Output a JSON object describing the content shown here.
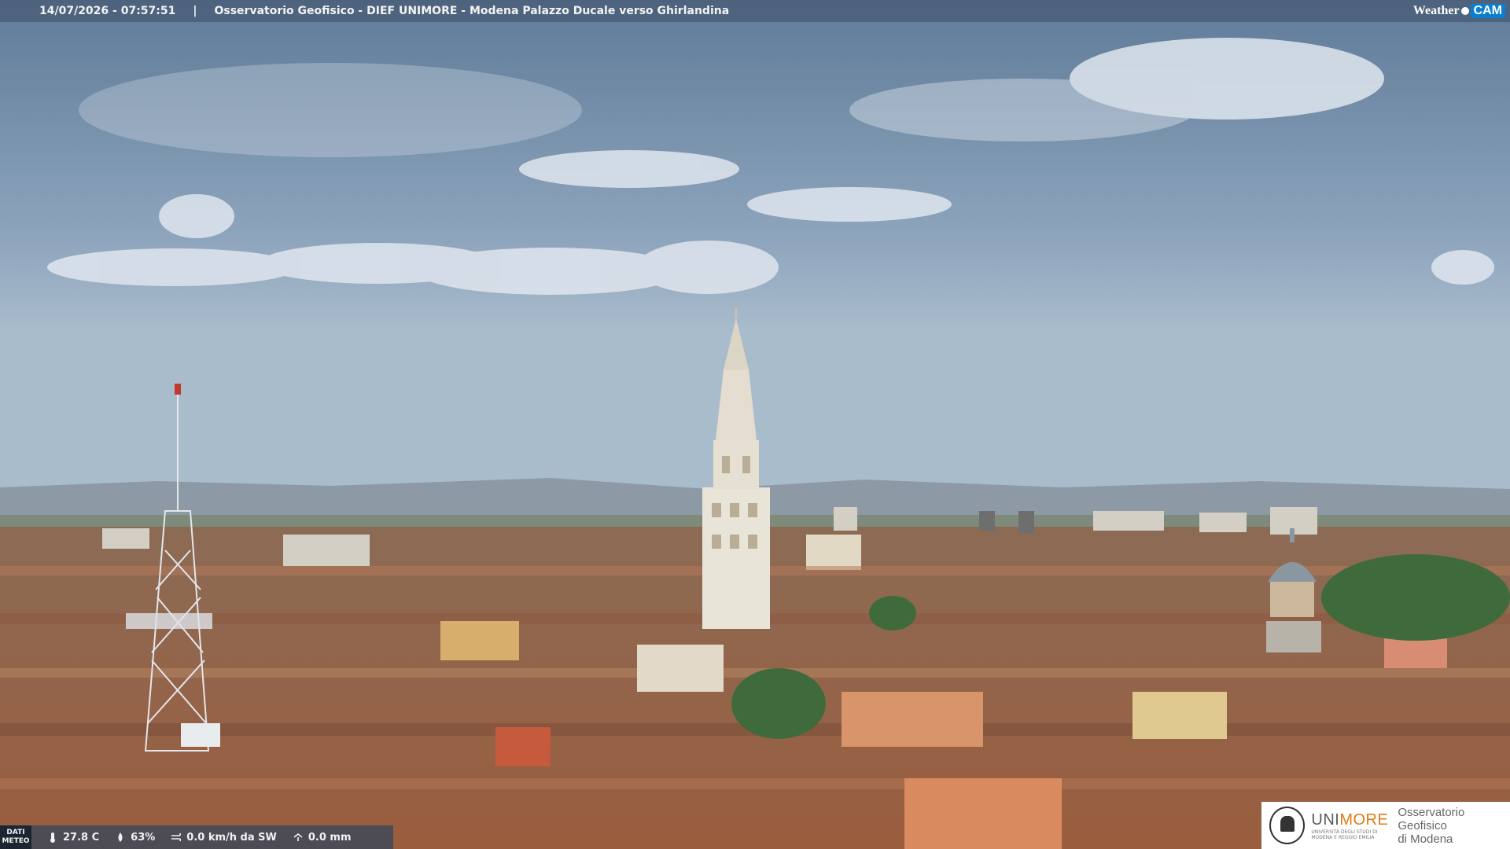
{
  "overlay": {
    "datetime": "14/07/2026 - 07:57:51",
    "separator": "|",
    "title": "Osservatorio Geofisico - DIEF UNIMORE - Modena Palazzo Ducale verso Ghirlandina",
    "brand_weather": "Weather",
    "brand_cam": "CAM"
  },
  "meteo": {
    "badge_line1": "DATI",
    "badge_line2": "METEO",
    "temperature": "27.8 C",
    "humidity": "63%",
    "wind": "0.0 km/h da SW",
    "rain": "0.0 mm",
    "icons": [
      "thermometer-icon",
      "humidity-drop-icon",
      "wind-icon",
      "rain-icon"
    ]
  },
  "logo": {
    "uni_prefix": "UNI",
    "uni_suffix": "MORE",
    "uni_sub": "UNIVERSITÀ DEGLI STUDI DI MODENA E REGGIO EMILIA",
    "obs_line1": "Osservatorio Geofisico",
    "obs_line2": "di Modena"
  },
  "colors": {
    "sky_top": "#6f8aa6",
    "sky_bottom": "#9fb3c7",
    "roof": "#a8704f",
    "tower": "#e8e2d6",
    "accent_orange": "#e07b16"
  }
}
